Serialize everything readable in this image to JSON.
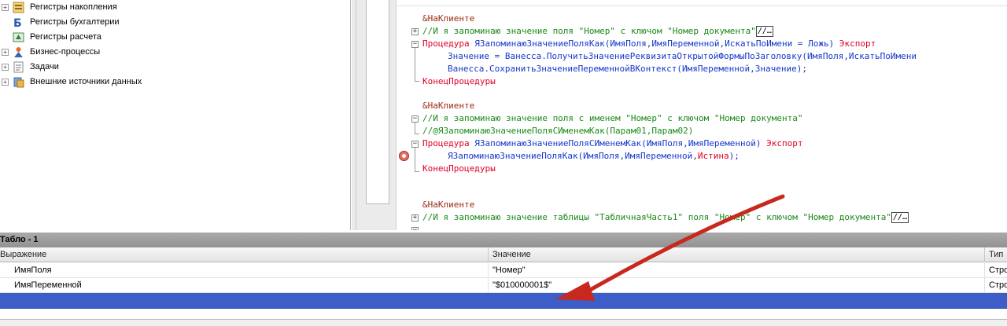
{
  "tree": {
    "items": [
      {
        "label": "Регистры накопления",
        "icon": "accumulation-register-icon",
        "expandable": true
      },
      {
        "label": "Регистры бухгалтерии",
        "icon": "accounting-register-icon",
        "expandable": false
      },
      {
        "label": "Регистры расчета",
        "icon": "calculation-register-icon",
        "expandable": false
      },
      {
        "label": "Бизнес-процессы",
        "icon": "business-process-icon",
        "expandable": true
      },
      {
        "label": "Задачи",
        "icon": "tasks-icon",
        "expandable": true
      },
      {
        "label": "Внешние источники данных",
        "icon": "external-data-icon",
        "expandable": true
      }
    ]
  },
  "editor": {
    "block1": {
      "directive": "&НаКлиенте",
      "comment": "//И я запоминаю значение поля \"Номер\" с ключом \"Номер документа\"",
      "ellipsis": "//…",
      "proc_kw": "Процедура",
      "proc_sig": "ЯЗапоминаюЗначениеПоляКак(ИмяПоля,ИмяПеременной,ИскатьПоИмени = Ложь)",
      "export_kw": "Экспорт",
      "body1": "Значение = Ванесса.ПолучитьЗначениеРеквизитаОткрытойФормыПоЗаголовку(ИмяПоля,ИскатьПоИмени",
      "body2_a": "Ванесса.СохранитьЗначениеПеременнойВКонтекст(ИмяПеременной,",
      "body2_b": "Значение",
      "body2_c": ");",
      "end_kw": "КонецПроцедуры"
    },
    "block2": {
      "directive": "&НаКлиенте",
      "comment": "//И я запоминаю значение поля с именем \"Номер\" с ключом \"Номер документа\"",
      "comment2": "//@ЯЗапоминаюЗначениеПоляСИменемКак(Парам01,Парам02)",
      "proc_kw": "Процедура",
      "proc_sig": "ЯЗапоминаюЗначениеПоляСИменемКак(ИмяПоля,ИмяПеременной)",
      "export_kw": "Экспорт",
      "body_a": "ЯЗапоминаюЗначениеПоляКак(ИмяПоля,ИмяПеременной,",
      "body_b": "Истина",
      "body_c": ");",
      "end_kw": "КонецПроцедуры"
    },
    "block3": {
      "directive": "&НаКлиенте",
      "comment": "//И я запоминаю значение таблицы \"ТабличнаяЧасть1\" поля \"Номер\" с ключом \"Номер документа\"",
      "ellipsis": "//…"
    }
  },
  "tablo": {
    "title": "Табло - 1",
    "columns": [
      "Выражение",
      "Значение",
      "Тип"
    ],
    "rows": [
      {
        "expr": "ИмяПоля",
        "value": "\"Номер\"",
        "type": "Стро"
      },
      {
        "expr": "ИмяПеременной",
        "value": "\"$010000001$\"",
        "type": "Стро"
      },
      {
        "expr": "",
        "value": "",
        "type": ""
      }
    ]
  },
  "annotation": {
    "color": "#c8281e"
  }
}
